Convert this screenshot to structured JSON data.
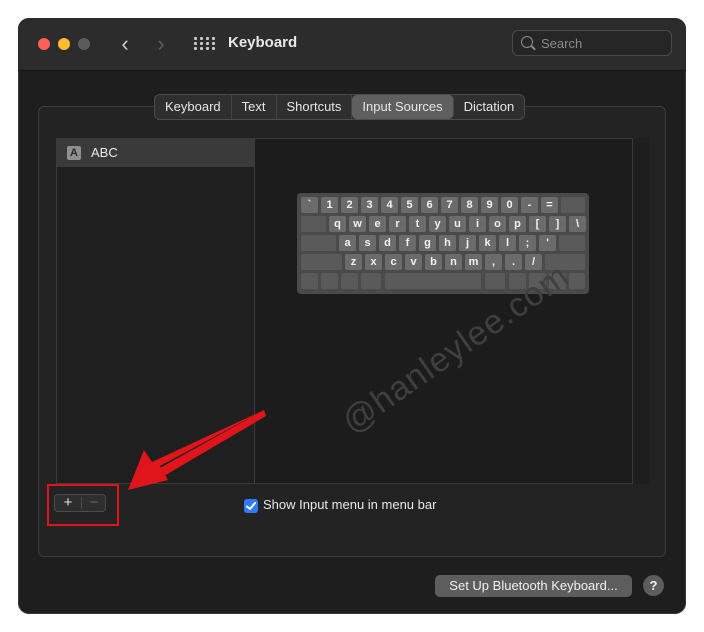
{
  "window": {
    "title": "Keyboard"
  },
  "search": {
    "placeholder": "Search"
  },
  "tabs": [
    {
      "label": "Keyboard",
      "active": false
    },
    {
      "label": "Text",
      "active": false
    },
    {
      "label": "Shortcuts",
      "active": false
    },
    {
      "label": "Input Sources",
      "active": true
    },
    {
      "label": "Dictation",
      "active": false
    }
  ],
  "sources": [
    {
      "icon_letter": "A",
      "label": "ABC",
      "selected": true
    }
  ],
  "keyboard_rows": [
    [
      "`",
      "1",
      "2",
      "3",
      "4",
      "5",
      "6",
      "7",
      "8",
      "9",
      "0",
      "-",
      "="
    ],
    [
      "q",
      "w",
      "e",
      "r",
      "t",
      "y",
      "u",
      "i",
      "o",
      "p",
      "[",
      "]",
      "\\"
    ],
    [
      "a",
      "s",
      "d",
      "f",
      "g",
      "h",
      "j",
      "k",
      "l",
      ";",
      "'"
    ],
    [
      "z",
      "x",
      "c",
      "v",
      "b",
      "n",
      "m",
      ",",
      ".",
      "/"
    ]
  ],
  "list_controls": {
    "add_label": "+",
    "remove_label": "−"
  },
  "show_input_menu": {
    "label": "Show Input menu in menu bar",
    "checked": true
  },
  "bluetooth_button": {
    "label": "Set Up Bluetooth Keyboard..."
  },
  "help_button": {
    "label": "?"
  },
  "watermark": {
    "text": "@hanleylee.com"
  },
  "colors": {
    "accent": "#2f7bf5",
    "annotation_red": "#e0141b"
  }
}
